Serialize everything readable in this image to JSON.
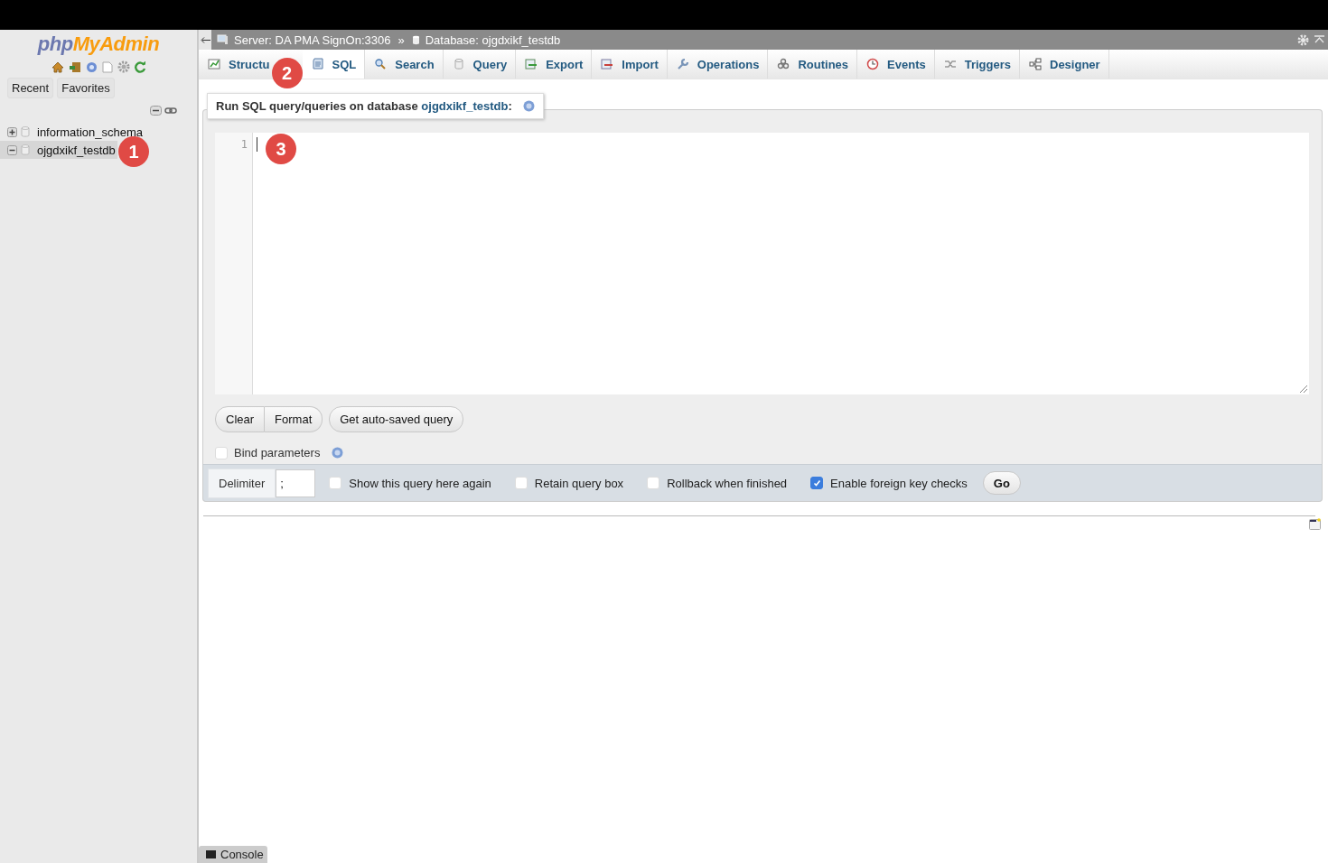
{
  "logo": {
    "part_1": "php",
    "part_2": "MyAdmin"
  },
  "sidebar": {
    "tabs": [
      {
        "label": "Recent"
      },
      {
        "label": "Favorites"
      }
    ],
    "tree": [
      {
        "name": "information_schema",
        "expanded": false,
        "selected": false
      },
      {
        "name": "ojgdxikf_testdb",
        "expanded": true,
        "selected": true
      }
    ]
  },
  "breadcrumb": {
    "server": "Server: DA PMA SignOn:3306",
    "separator": "»",
    "database": "Database: ojgdxikf_testdb"
  },
  "tabs": [
    {
      "label": "Structu",
      "selected": false
    },
    {
      "label": "SQL",
      "selected": true
    },
    {
      "label": "Search",
      "selected": false
    },
    {
      "label": "Query",
      "selected": false
    },
    {
      "label": "Export",
      "selected": false
    },
    {
      "label": "Import",
      "selected": false
    },
    {
      "label": "Operations",
      "selected": false
    },
    {
      "label": "Routines",
      "selected": false
    },
    {
      "label": "Events",
      "selected": false
    },
    {
      "label": "Triggers",
      "selected": false
    },
    {
      "label": "Designer",
      "selected": false
    }
  ],
  "query": {
    "legend": "Run SQL query/queries on database ",
    "database_link": "ojgdxikf_testdb",
    "legend_end": ":",
    "line_numbers": [
      "1"
    ],
    "buttons": [
      {
        "label": "Clear"
      },
      {
        "label": "Format"
      },
      {
        "label": "Get auto-saved query"
      }
    ],
    "bind_parameters": {
      "label": "Bind parameters",
      "checked": false
    }
  },
  "options": {
    "delimiter_label": "Delimiter",
    "delimiter_value": ";",
    "checkboxes": [
      {
        "label": "Show this query here again",
        "checked": false
      },
      {
        "label": "Retain query box",
        "checked": false
      },
      {
        "label": "Rollback when finished",
        "checked": false
      },
      {
        "label": "Enable foreign key checks",
        "checked": true
      }
    ],
    "go": "Go"
  },
  "console": "Console",
  "annotations": [
    "1",
    "2",
    "3"
  ]
}
